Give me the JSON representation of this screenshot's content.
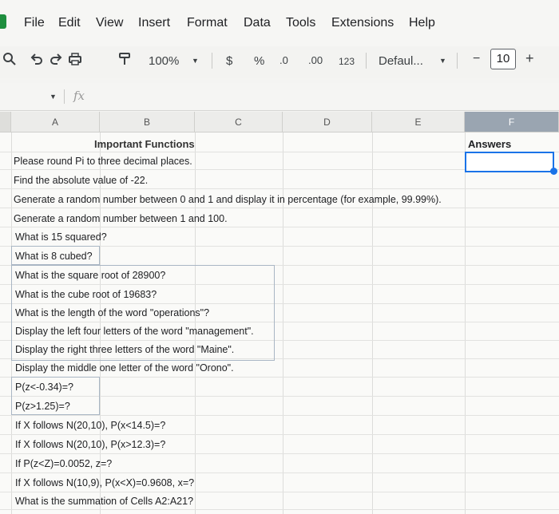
{
  "menu": [
    "File",
    "Edit",
    "View",
    "Insert",
    "Format",
    "Data",
    "Tools",
    "Extensions",
    "Help"
  ],
  "toolbar": {
    "zoom": "100%",
    "currency": "$",
    "percent": "%",
    "dec_decrease": ".0",
    "dec_increase": ".00",
    "number_format": "123",
    "font": "Defaul...",
    "minus": "−",
    "font_size": "10",
    "plus": "+"
  },
  "formula_bar": {
    "fx": "fx",
    "value": ""
  },
  "columns": [
    "A",
    "B",
    "C",
    "D",
    "E",
    "F"
  ],
  "sheet": {
    "title": "Important Functions",
    "answers_header": "Answers",
    "questions": [
      "Please round Pi to three decimal places.",
      "Find the absolute value of -22.",
      "Generate a random number between 0 and 1 and display it in percentage (for example, 99.99%).",
      "Generate a random number between 1 and 100.",
      "What is 15 squared?",
      "What is 8 cubed?",
      "What is the square root of 28900?",
      "What is the cube root of 19683?",
      "What is the length of the word \"operations\"?",
      "Display the left four letters of the word \"management\".",
      "Display the right three letters of the word \"Maine\".",
      "Display the middle one letter of the word \"Orono\".",
      "P(z<-0.34)=?",
      "P(z>1.25)=?",
      "If X follows N(20,10), P(x<14.5)=?",
      "If X follows N(20,10), P(x>12.3)=?",
      "If P(z<Z)=0.0052, z=?",
      "If X follows N(10,9), P(x<X)=0.9608, x=?",
      "What is the summation of Cells A2:A21?"
    ]
  },
  "colors": {
    "selection": "#1a73e8",
    "sheets_green": "#1e8e3e"
  }
}
